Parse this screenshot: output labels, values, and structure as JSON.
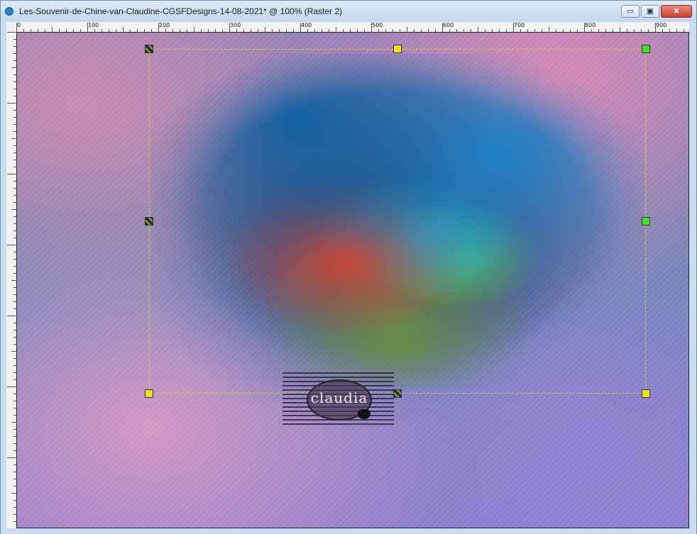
{
  "window": {
    "title": "Les-Souvenir-de-Chine-van-Claudine-CGSFDesigns-14-08-2021* @ 100% (Raster 2)",
    "buttons": {
      "minimize": "▭",
      "maximize": "▣",
      "close": "✕"
    }
  },
  "ruler": {
    "labels": [
      "0",
      "100",
      "200",
      "300",
      "400",
      "500",
      "600",
      "700",
      "800",
      "900"
    ]
  },
  "canvas": {
    "watermark_text": "claudia",
    "colors": {
      "selection": "#d8cf3a",
      "handle_yellow": "#f3e21b",
      "handle_green": "#3ee22c"
    }
  }
}
